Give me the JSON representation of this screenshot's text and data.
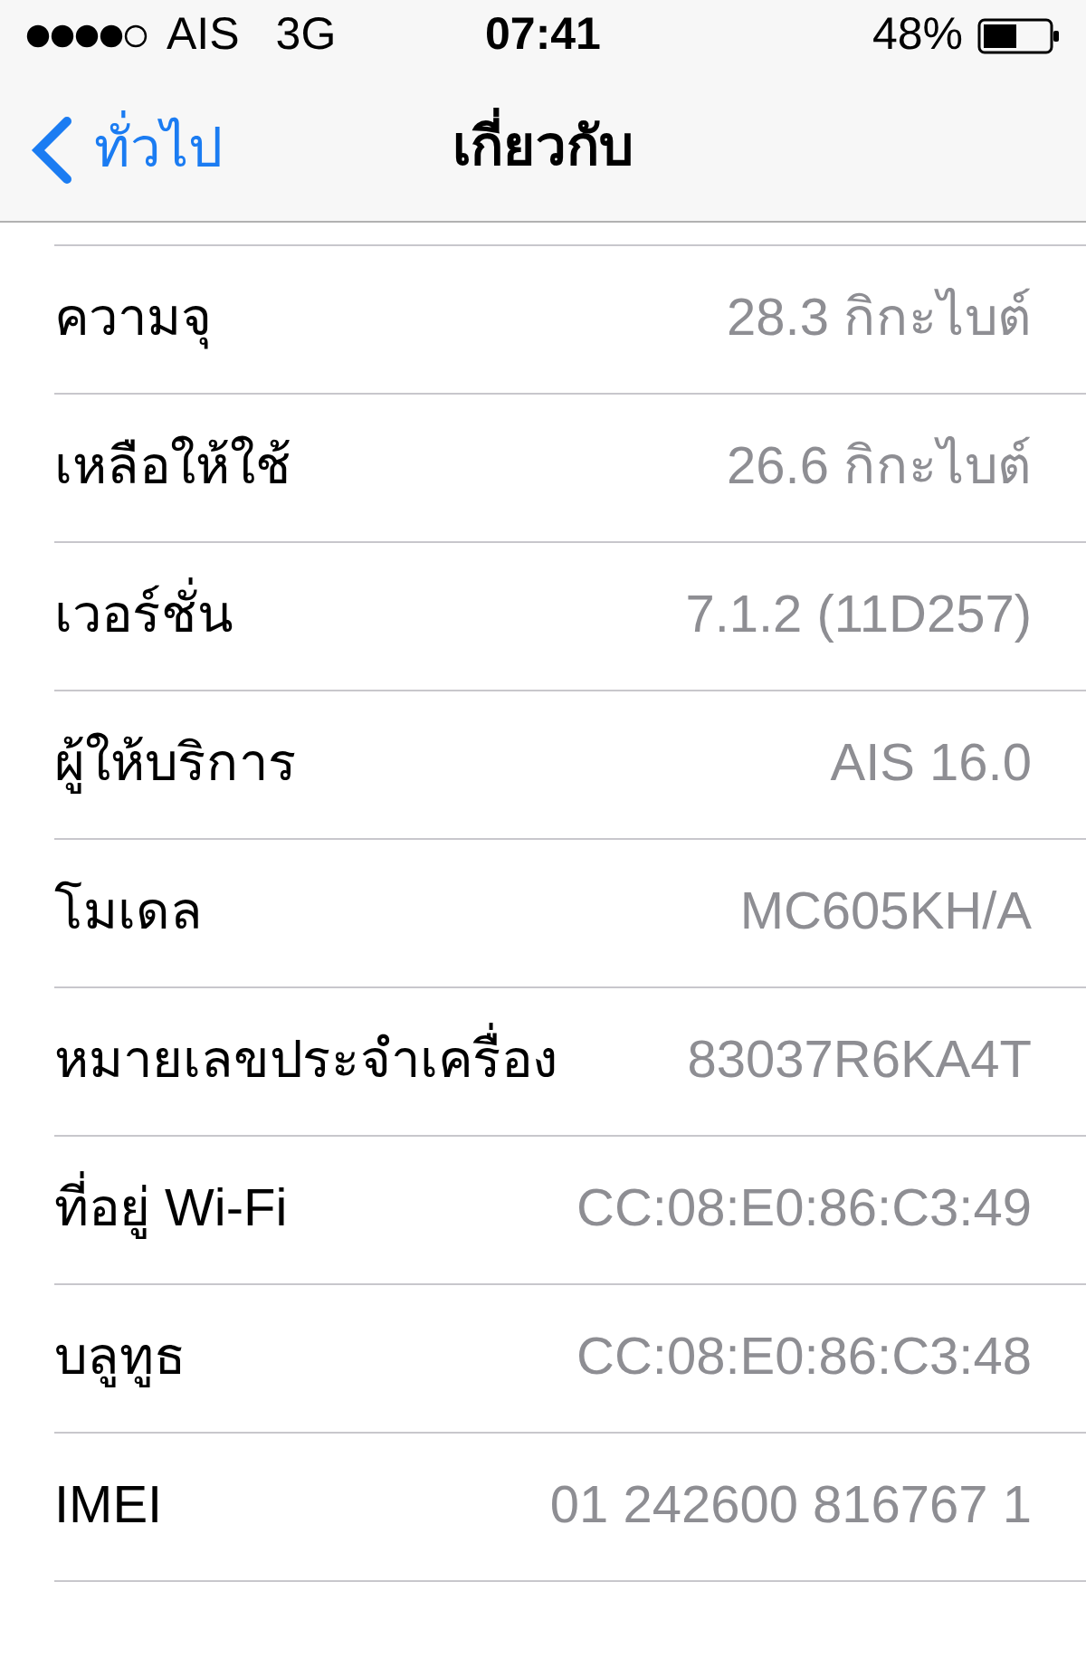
{
  "status_bar": {
    "carrier": "AIS",
    "network": "3G",
    "time": "07:41",
    "battery": "48%"
  },
  "nav_bar": {
    "back": "ทั่วไป",
    "title": "เกี่ยวกับ"
  },
  "rows": [
    {
      "label": "ความจุ",
      "value": "28.3 กิกะไบต์"
    },
    {
      "label": "เหลือให้ใช้",
      "value": "26.6 กิกะไบต์"
    },
    {
      "label": "เวอร์ชั่น",
      "value": "7.1.2 (11D257)"
    },
    {
      "label": "ผู้ให้บริการ",
      "value": "AIS 16.0"
    },
    {
      "label": "โมเดล",
      "value": "MC605KH/A"
    },
    {
      "label": "หมายเลขประจำเครื่อง",
      "value": "83037R6KA4T"
    },
    {
      "label": "ที่อยู่ Wi-Fi",
      "value": "CC:08:E0:86:C3:49"
    },
    {
      "label": "บลูทูธ",
      "value": "CC:08:E0:86:C3:48"
    },
    {
      "label": "IMEI",
      "value": "01 242600 816767 1"
    }
  ]
}
